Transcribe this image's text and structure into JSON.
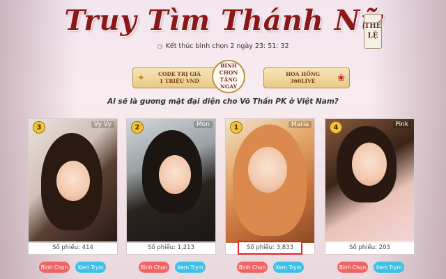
{
  "header": {
    "title": "Truy Tìm Thánh Nữ",
    "rules_label_line1": "THỂ",
    "rules_label_line2": "LỆ",
    "timer_text": "Kết thúc bình chọn 2 ngày 23: 51: 32"
  },
  "promos": {
    "left_line1": "CODE TRỊ GIÁ",
    "left_line2": "1 TRIỆU VND",
    "center_line1": "BÌNH CHỌN",
    "center_line2": "TẶNG NGAY",
    "right_line1": "HOA HỒNG",
    "right_line2": "360LIVE"
  },
  "question": "Ai sẽ là gương mặt đại diện cho Võ Thần PK ở Việt Nam?",
  "cards": [
    {
      "name": "Vy Vy",
      "rank": "3",
      "votes_text": "Số phiếu: 414",
      "vote_label": "Bình Chọn",
      "view_label": "Xem Trym"
    },
    {
      "name": "Mon",
      "rank": "2",
      "votes_text": "Số phiếu: 1,213",
      "vote_label": "Bình Chọn",
      "view_label": "Xem Trym"
    },
    {
      "name": "Maria",
      "rank": "1",
      "votes_text": "Số phiếu: 3,833",
      "vote_label": "Bình Chọn",
      "view_label": "Xem Trym"
    },
    {
      "name": "Pink",
      "rank": "4",
      "votes_text": "Số phiếu: 203",
      "vote_label": "Bình Chọn",
      "view_label": "Xem Trym"
    }
  ],
  "colors": {
    "title": "#8a1818",
    "vote_button": "#f26363",
    "view_button": "#3ec1e6",
    "highlight": "#e4242a"
  },
  "icons": {
    "timer": "clock-icon",
    "left_promo": "gift-icon",
    "right_promo": "rose-icon",
    "rank": "medal-icon"
  }
}
